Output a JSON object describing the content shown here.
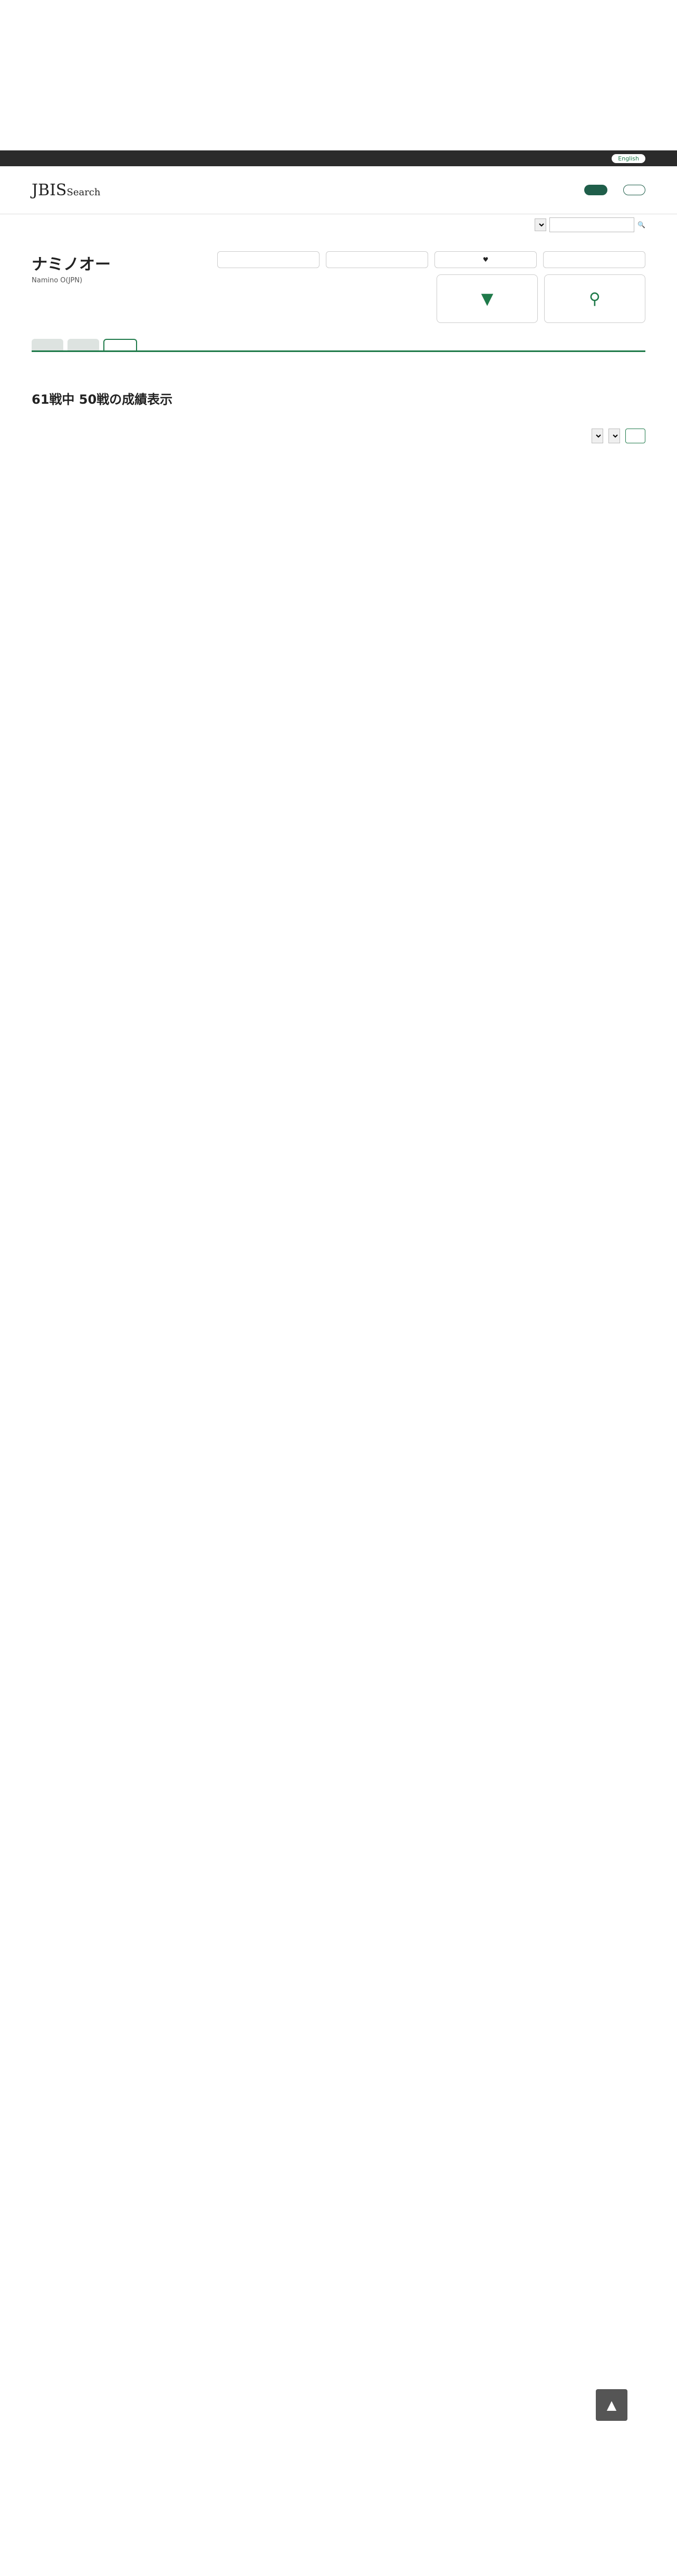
{
  "header": {
    "site_notice": "",
    "nav": [],
    "premium_button": "",
    "member_button": ""
  },
  "horse": {
    "name": "ナミノオー",
    "name_en": "Namino O(JPN)"
  },
  "section_title": "61戦中 50戦の成績表示",
  "table": {
    "columns": [],
    "rows": []
  },
  "more_link": ""
}
